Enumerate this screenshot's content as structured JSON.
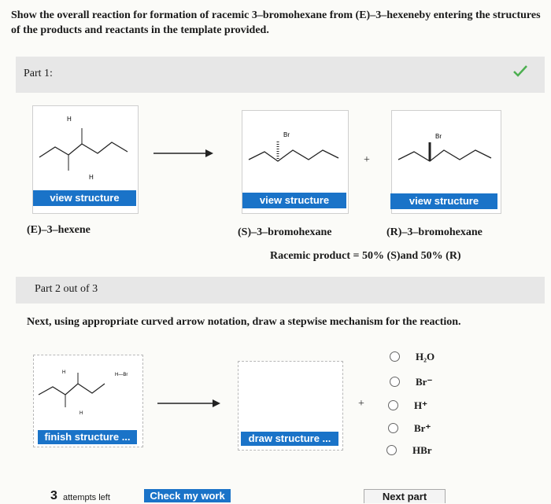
{
  "question": "Show the overall reaction for formation of racemic 3–bromohexane from (E)–3–hexeneby entering the structures of the products and reactants in the template provided.",
  "part1": {
    "title": "Part 1:",
    "view_label": "view structure",
    "reactant_label": "(E)–3–hexene",
    "product1_label": "(S)–3–bromohexane",
    "product2_label": "(R)–3–bromohexane",
    "racemic_note": "Racemic product = 50% (S)and 50% (R)",
    "plus": "+",
    "atoms": {
      "H": "H",
      "Br": "Br"
    }
  },
  "part2": {
    "title": "Part 2 out of 3",
    "instruction": "Next, using appropriate curved arrow notation, draw a stepwise mechanism for the reaction.",
    "finish_label": "finish structure ...",
    "draw_label": "draw structure ...",
    "hbr_label": "H—Br",
    "plus": "+",
    "options": [
      "H₂O",
      "Br⁻",
      "H⁺",
      "Br⁺",
      "HBr"
    ]
  },
  "footer": {
    "attempts_count": "3",
    "attempts_text": "attempts left",
    "check_label": "Check my work",
    "next_label": "Next part"
  },
  "colors": {
    "accent": "#1a73c8",
    "check": "#4caf50",
    "band": "#e7e7e7"
  }
}
